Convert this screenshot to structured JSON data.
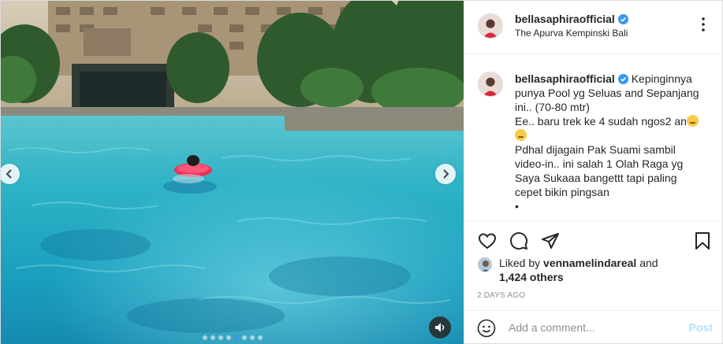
{
  "post": {
    "username": "bellasaphiraofficial",
    "location": "The Apurva Kempinski Bali",
    "caption": {
      "username": "bellasaphiraofficial",
      "lines": [
        "Kepinginnya",
        "punya Pool yg Seluas and Sepanjang",
        "ini.. (70-80 mtr)",
        "Ee.. baru trek ke 4 sudah ngos2 an",
        "",
        "Pdhal dijagain Pak Suami sambil",
        "video-in.. ini salah 1 Olah Raga yg",
        "Saya Sukaaa bangettt tapi paling",
        "cepet bikin pingsan",
        "•"
      ]
    },
    "likes": {
      "prefix": "Liked by",
      "liker": "vennamelindareal",
      "and": "and",
      "others": "1,424 others"
    },
    "time": "2 DAYS AGO"
  },
  "comment": {
    "placeholder": "Add a comment...",
    "post_label": "Post"
  },
  "carousel": {
    "count": 8,
    "active_index": 4
  },
  "colors": {
    "verified": "#3897f0",
    "post_disabled": "#b2dffc",
    "muted": "#8e8e8e"
  },
  "icons": [
    "chevron-left-icon",
    "chevron-right-icon",
    "sound-muted-icon",
    "more-icon",
    "heart-icon",
    "comment-icon",
    "share-icon",
    "bookmark-icon",
    "emoji-icon",
    "verified-badge-icon"
  ]
}
